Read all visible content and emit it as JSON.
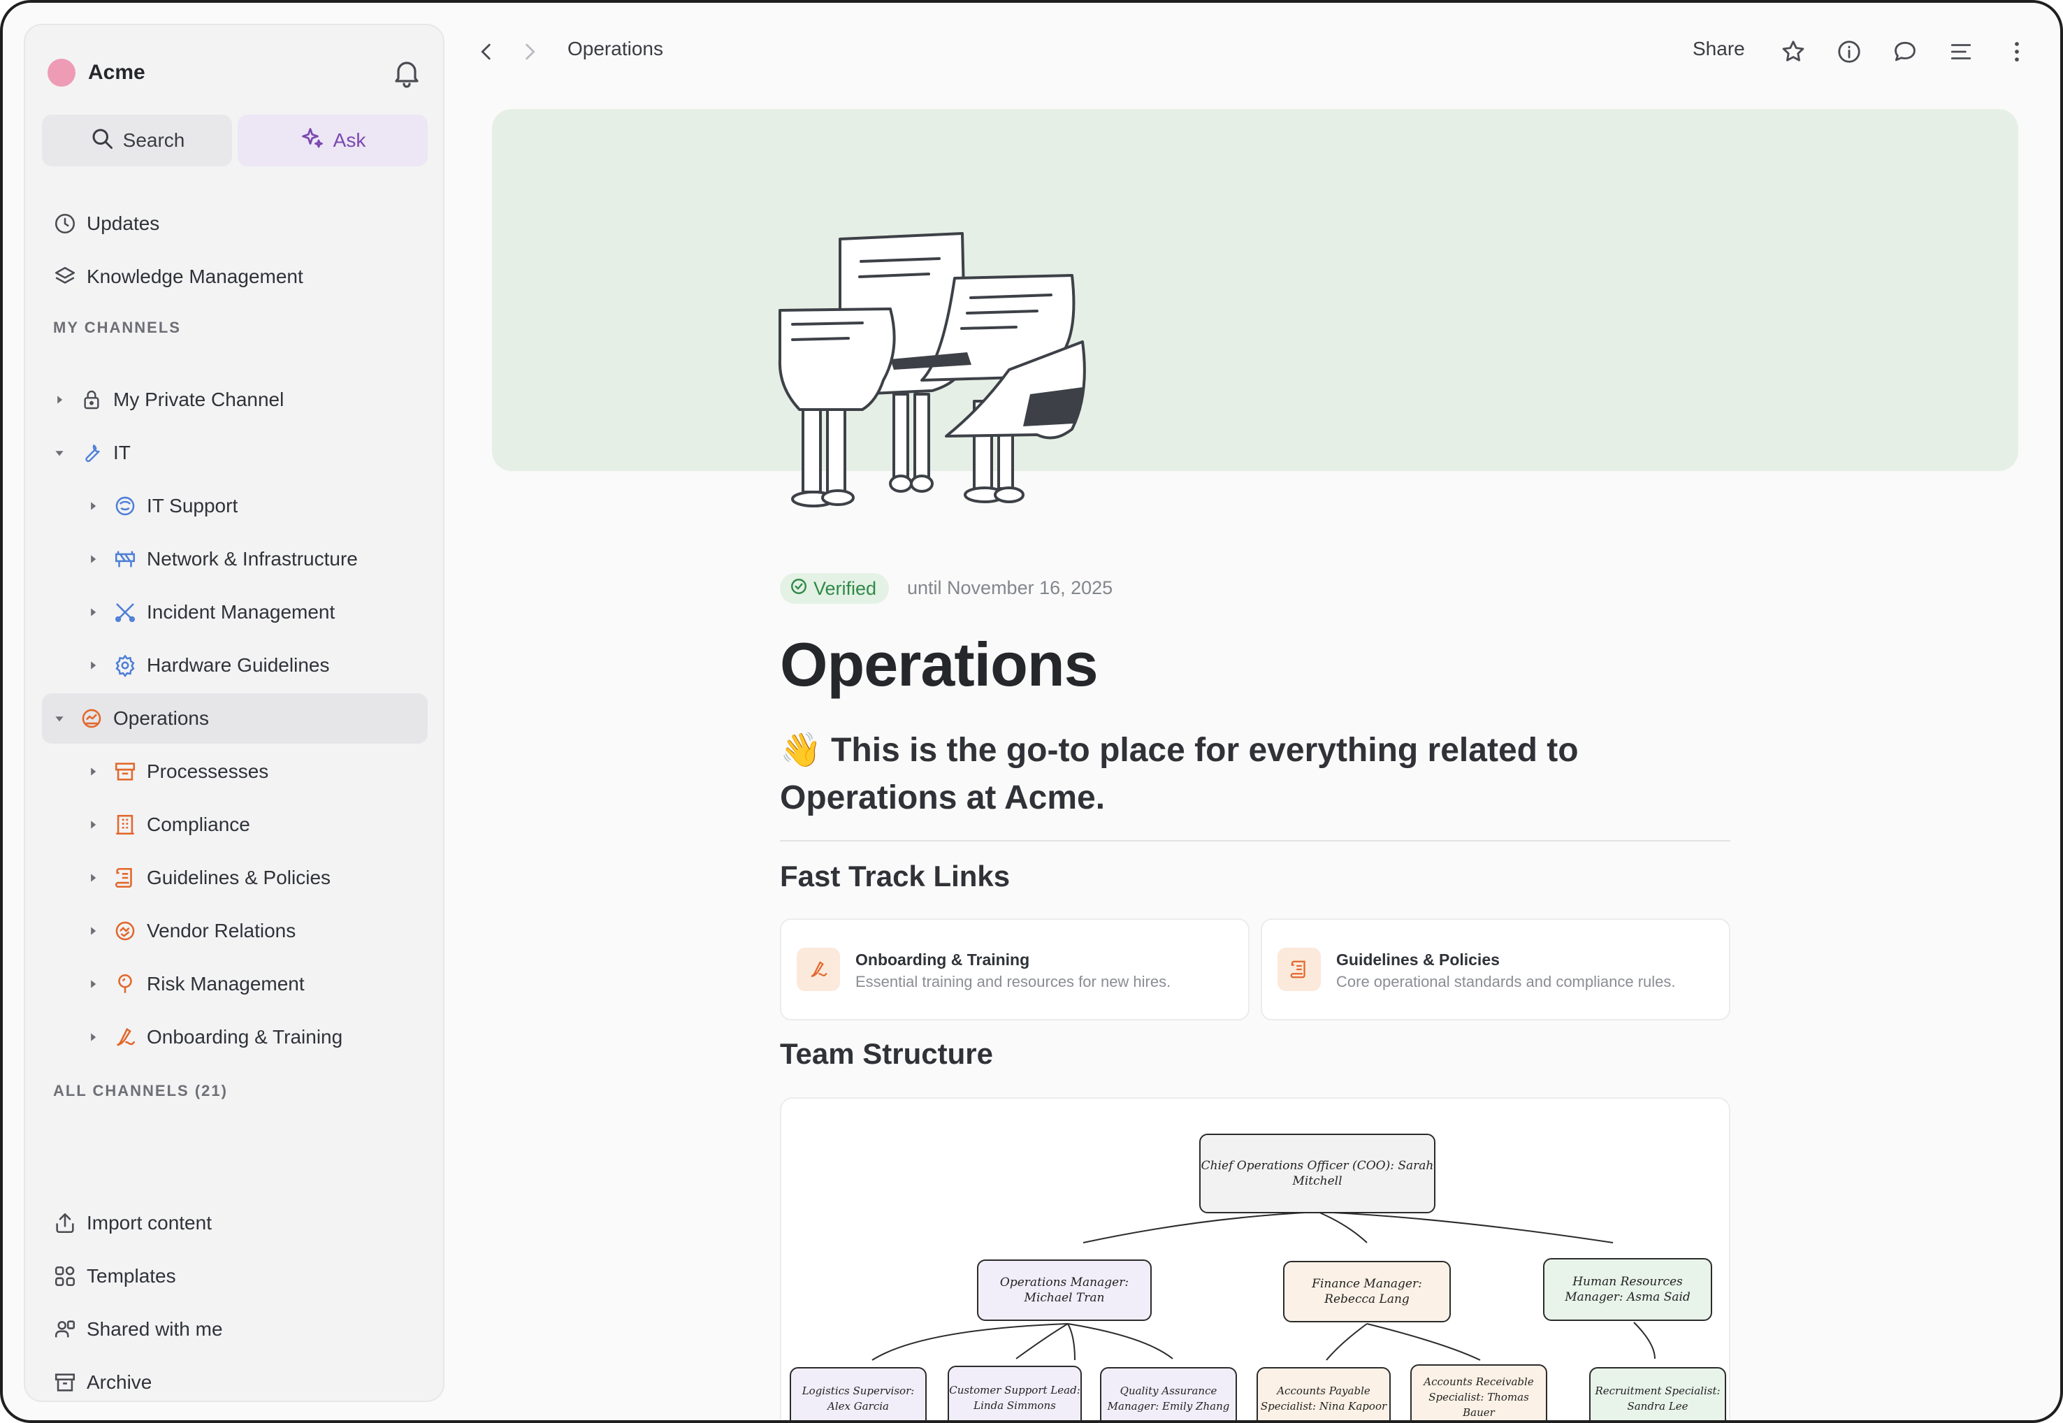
{
  "workspace": {
    "name": "Acme"
  },
  "sidebar": {
    "search_label": "Search",
    "ask_label": "Ask",
    "top_items": [
      {
        "label": "Updates",
        "icon": "clock-icon"
      },
      {
        "label": "Knowledge Management",
        "icon": "layers-icon"
      }
    ],
    "my_channels_label": "MY CHANNELS",
    "channels": [
      {
        "label": "My Private Channel",
        "icon": "lock-icon",
        "level": 0,
        "expanded": false
      },
      {
        "label": "IT",
        "icon": "wrench-icon",
        "level": 0,
        "expanded": true
      },
      {
        "label": "IT Support",
        "icon": "support-icon",
        "level": 1
      },
      {
        "label": "Network & Infrastructure",
        "icon": "network-icon",
        "level": 1
      },
      {
        "label": "Incident Management",
        "icon": "incident-icon",
        "level": 1
      },
      {
        "label": "Hardware Guidelines",
        "icon": "gear-icon",
        "level": 1
      },
      {
        "label": "Operations",
        "icon": "operations-icon",
        "level": 0,
        "expanded": true,
        "active": true
      },
      {
        "label": "Processesses",
        "icon": "process-icon",
        "level": 1
      },
      {
        "label": "Compliance",
        "icon": "building-icon",
        "level": 1
      },
      {
        "label": "Guidelines & Policies",
        "icon": "scroll-icon",
        "level": 1
      },
      {
        "label": "Vendor Relations",
        "icon": "handshake-icon",
        "level": 1
      },
      {
        "label": "Risk Management",
        "icon": "pin-icon",
        "level": 1
      },
      {
        "label": "Onboarding & Training",
        "icon": "sign-icon",
        "level": 1
      }
    ],
    "all_channels_label": "ALL CHANNELS (21)",
    "bottom_items": [
      {
        "label": "Import content",
        "icon": "upload-icon"
      },
      {
        "label": "Templates",
        "icon": "templates-icon"
      },
      {
        "label": "Shared with me",
        "icon": "shared-icon"
      },
      {
        "label": "Archive",
        "icon": "archive-icon"
      }
    ]
  },
  "topbar": {
    "breadcrumb": "Operations",
    "share_label": "Share"
  },
  "page": {
    "verified_label": "Verified",
    "verified_until": "until November 16, 2025",
    "title": "Operations",
    "lead": "👋 This is the go-to place for everything related to Operations at Acme.",
    "fast_track_heading": "Fast Track Links",
    "fast_track_cards": [
      {
        "title": "Onboarding & Training",
        "desc": "Essential training and resources for new hires.",
        "icon": "sign-icon"
      },
      {
        "title": "Guidelines & Policies",
        "desc": "Core operational standards and compliance rules.",
        "icon": "scroll-icon"
      }
    ],
    "team_heading": "Team Structure",
    "org_chart": {
      "root": "Chief Operations Officer (COO): Sarah Mitchell",
      "managers": [
        "Operations Manager: Michael Tran",
        "Finance Manager: Rebecca Lang",
        "Human Resources Manager: Asma Said"
      ],
      "staff": [
        "Logistics Supervisor: Alex Garcia",
        "Customer Support Lead: Linda Simmons",
        "Quality Assurance Manager: Emily Zhang",
        "Accounts Payable Specialist: Nina Kapoor",
        "Accounts Receivable Specialist: Thomas Bauer",
        "Recruitment Specialist: Sandra Lee"
      ]
    }
  },
  "colors": {
    "accent_purple": "#7a48b0",
    "it_blue": "#4f7fd6",
    "operations_orange": "#e2672b",
    "verified_green": "#2f8a47",
    "cover_green": "#e6efe6"
  }
}
